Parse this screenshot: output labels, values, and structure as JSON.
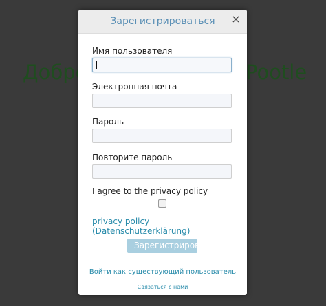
{
  "background": {
    "welcome_left": "Добро",
    "welcome_right": "Pootle"
  },
  "dialog": {
    "title": "Зарегистрироваться",
    "close_glyph": "×",
    "fields": [
      {
        "label": "Имя пользователя",
        "value": "",
        "placeholder": ""
      },
      {
        "label": "Электронная почта",
        "value": "",
        "placeholder": ""
      },
      {
        "label": "Пароль",
        "value": "",
        "placeholder": ""
      },
      {
        "label": "Повторите пароль",
        "value": "",
        "placeholder": ""
      }
    ],
    "agree_label": "I agree to the privacy policy",
    "agree_checked": false,
    "policy_link": "privacy policy (Datenschutzerklärung)",
    "submit_label": "Зарегистрироваться",
    "existing_user_link": "Войти как существующий пользователь",
    "contact_link": "Связаться с нами"
  },
  "colors": {
    "title": "#5a8fb5",
    "link": "#2a8cab",
    "submit_bg": "#a9cfe0",
    "welcome": "#1f4d1f",
    "overlay": "#3a3a3a"
  }
}
